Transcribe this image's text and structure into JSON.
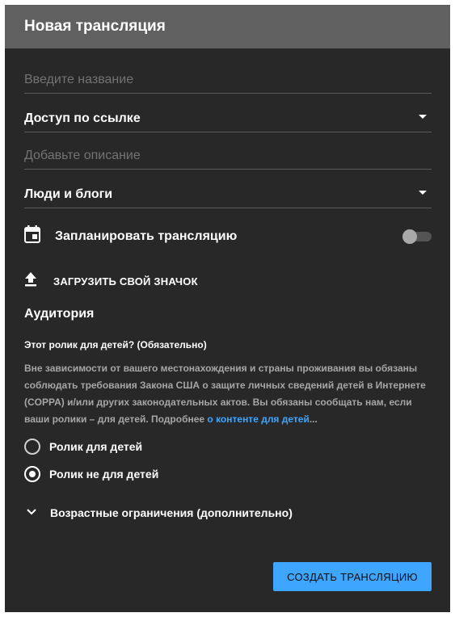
{
  "dialog": {
    "title": "Новая трансляция"
  },
  "form": {
    "title_placeholder": "Введите название",
    "access_value": "Доступ по ссылке",
    "description_placeholder": "Добавьте описание",
    "category_value": "Люди и блоги",
    "schedule_label": "Запланировать трансляцию",
    "schedule_enabled": false,
    "upload_thumbnail_label": "ЗАГРУЗИТЬ СВОЙ ЗНАЧОК"
  },
  "audience": {
    "title": "Аудитория",
    "question": "Этот ролик для детей? (Обязательно)",
    "description_text": "Вне зависимости от вашего местонахождения и страны проживания вы обязаны соблюдать требования Закона США о защите личных сведений детей в Интернете (COPPA) и/или других законодательных актов. Вы обязаны сообщать нам, если ваши ролики – для детей. Подробнее ",
    "description_link": "о контенте для детей",
    "description_ellipsis": "...",
    "options": [
      {
        "label": "Ролик для детей",
        "selected": false
      },
      {
        "label": "Ролик не для детей",
        "selected": true
      }
    ],
    "age_restrictions_label": "Возрастные ограничения (дополнительно)"
  },
  "actions": {
    "create_label": "СОЗДАТЬ ТРАНСЛЯЦИЮ"
  },
  "colors": {
    "dialog_bg": "#282828",
    "header_bg": "#606060",
    "accent": "#3ea6ff"
  },
  "icons": {
    "schedule": "calendar-icon",
    "upload": "upload-icon",
    "expand": "chevron-down-icon",
    "dropdown": "caret-down-icon"
  }
}
